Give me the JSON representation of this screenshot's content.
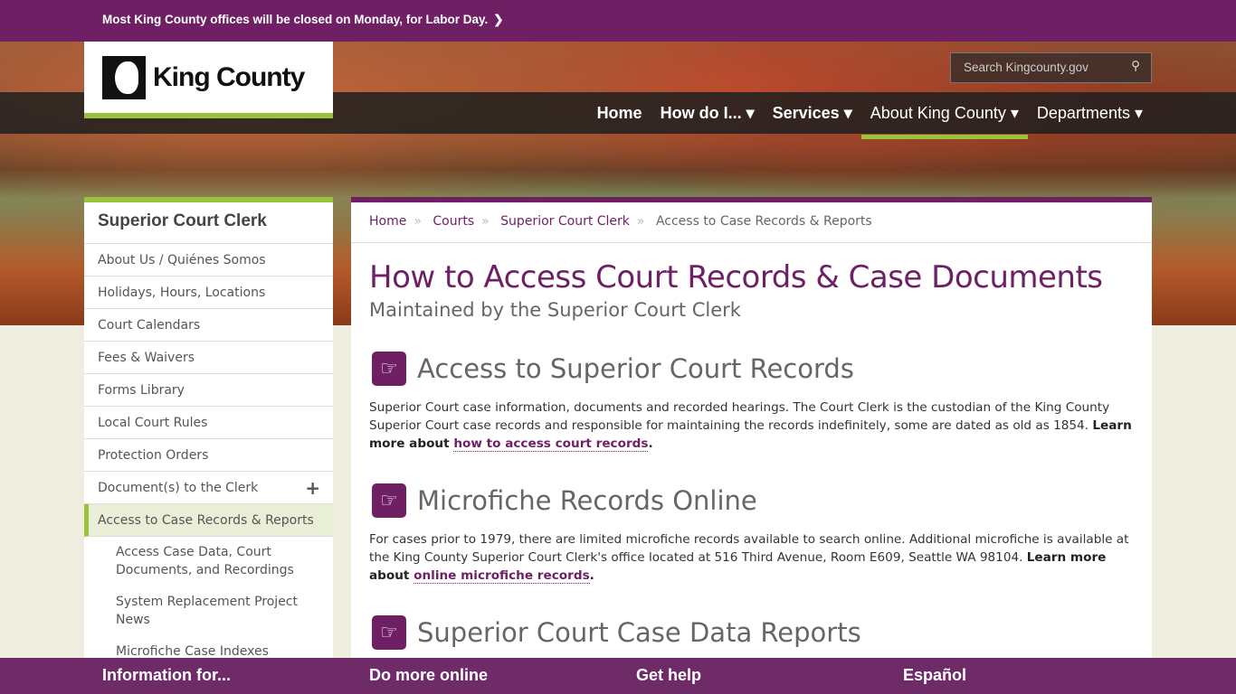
{
  "alert": {
    "text": "Most King County offices will be closed on Monday, for Labor Day.",
    "icon": "chevron-right-icon"
  },
  "logo": {
    "text": "King County"
  },
  "search": {
    "placeholder": "Search Kingcounty.gov",
    "icon": "search-icon"
  },
  "nav": [
    "Home",
    "How do I...",
    "Services",
    "About King County",
    "Departments"
  ],
  "sidebar": {
    "title": "Superior Court Clerk",
    "items": [
      "About Us / Quiénes Somos",
      "Holidays, Hours, Locations",
      "Court Calendars",
      "Fees & Waivers",
      "Forms Library",
      "Local Court Rules",
      "Protection Orders",
      "Document(s) to the Clerk",
      "Access to Case Records & Reports"
    ],
    "subitems": [
      "Access Case Data, Court Documents, and Recordings",
      "System Replacement Project News",
      "Microfiche Case Indexes"
    ]
  },
  "breadcrumb": [
    "Home",
    "Courts",
    "Superior Court Clerk",
    "Access to Case Records & Reports"
  ],
  "main": {
    "title": "How to Access Court Records & Case Documents",
    "subtitle": "Maintained by the Superior Court Clerk",
    "sections": [
      {
        "heading": "Access to Superior Court Records",
        "text": "Superior Court case information, documents and recorded hearings. The Court Clerk is the custodian of the King County Superior Court case records and responsible for maintaining the records indefinitely, some are dated as old as 1854.  ",
        "bold": "Learn more about ",
        "link": "how to access court records",
        "end": "."
      },
      {
        "heading": "Microfiche Records Online",
        "text": "For cases prior to 1979, there are limited microfiche records available to search online. Additional microfiche is available at the King County Superior Court Clerk's office located at 516 Third Avenue, Room E609, Seattle WA 98104. ",
        "bold": "Learn more about ",
        "link": "online microfiche records",
        "end": "."
      },
      {
        "heading": "Superior Court Case Data Reports"
      }
    ]
  },
  "footer": [
    "Information for...",
    "Do more online",
    "Get help",
    "Español"
  ],
  "colors": {
    "brand": "#6f1f64",
    "accent": "#9bc23c"
  }
}
